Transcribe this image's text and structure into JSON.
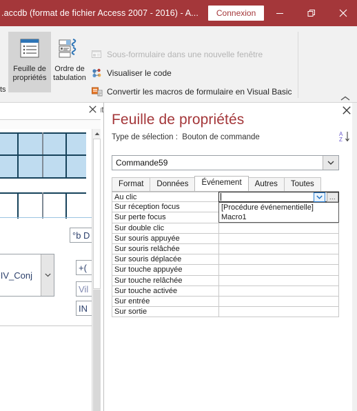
{
  "titlebar": {
    "document_title": ".accdb (format de fichier Access 2007 - 2016)  -  A...",
    "signin_label": "Connexion",
    "minimize_icon": "minimize-icon",
    "restore_icon": "restore-icon",
    "close_icon": "close-icon",
    "bg_color": "#a4373a"
  },
  "ribbon": {
    "buttons": [
      {
        "label_line1": "Feuille de",
        "label_line2": "propriétés",
        "icon": "property-sheet-icon",
        "selected": true
      },
      {
        "label_line1": "Ordre de",
        "label_line2": "tabulation",
        "icon": "tab-order-icon",
        "selected": false
      }
    ],
    "truncated_left_label": "ts",
    "items": [
      {
        "label": "Sous-formulaire dans une nouvelle fenêtre",
        "icon": "subform-window-icon",
        "disabled": true
      },
      {
        "label": "Visualiser le code",
        "icon": "view-code-icon",
        "disabled": false
      },
      {
        "label": "Convertir les macros de formulaire en Visual Basic",
        "icon": "convert-macros-icon",
        "disabled": false
      }
    ],
    "group_label": "Outils",
    "collapse_icon": "chevron-up-icon"
  },
  "design": {
    "close_icon": "close-icon",
    "scroll_up_icon": "scroll-up-arrow-icon",
    "controls": [
      {
        "name": "combo-indiv-conj",
        "text": "NDIV_Conj",
        "arrow_icon": "chevron-down-icon"
      },
      {
        "name": "textbox-pb",
        "text": "°b D"
      },
      {
        "name": "textbox-plus",
        "text": "+("
      },
      {
        "name": "textbox-vil",
        "text": "Vil"
      },
      {
        "name": "textbox-in",
        "text": "IN"
      }
    ]
  },
  "property_sheet": {
    "title": "Feuille de propriétés",
    "selection_label": "Type de sélection :",
    "selection_type": "Bouton de commande",
    "close_icon": "close-icon",
    "sort_icon": "sort-az-icon",
    "selected_object": "Commande59",
    "object_dropdown_icon": "chevron-down-icon",
    "tabs": [
      {
        "label": "Format",
        "active": false
      },
      {
        "label": "Données",
        "active": false
      },
      {
        "label": "Événement",
        "active": true
      },
      {
        "label": "Autres",
        "active": false
      },
      {
        "label": "Toutes",
        "active": false
      }
    ],
    "properties": [
      {
        "name": "Au clic",
        "value": "",
        "active": true
      },
      {
        "name": "Sur réception focus",
        "value": "",
        "active": false
      },
      {
        "name": "Sur perte focus",
        "value": "",
        "active": false
      },
      {
        "name": "Sur double clic",
        "value": "",
        "active": false
      },
      {
        "name": "Sur souris appuyée",
        "value": "",
        "active": false
      },
      {
        "name": "Sur souris relâchée",
        "value": "",
        "active": false
      },
      {
        "name": "Sur souris déplacée",
        "value": "",
        "active": false
      },
      {
        "name": "Sur touche appuyée",
        "value": "",
        "active": false
      },
      {
        "name": "Sur touche relâchée",
        "value": "",
        "active": false
      },
      {
        "name": "Sur touche activée",
        "value": "",
        "active": false
      },
      {
        "name": "Sur entrée",
        "value": "",
        "active": false
      },
      {
        "name": "Sur sortie",
        "value": "",
        "active": false
      }
    ],
    "editor": {
      "dropdown_arrow_icon": "chevron-down-icon",
      "builder_button_label": "...",
      "builder_icon": "ellipsis-builder-icon"
    },
    "dropdown_options": [
      "[Procédure événementielle]",
      "Macro1"
    ]
  }
}
